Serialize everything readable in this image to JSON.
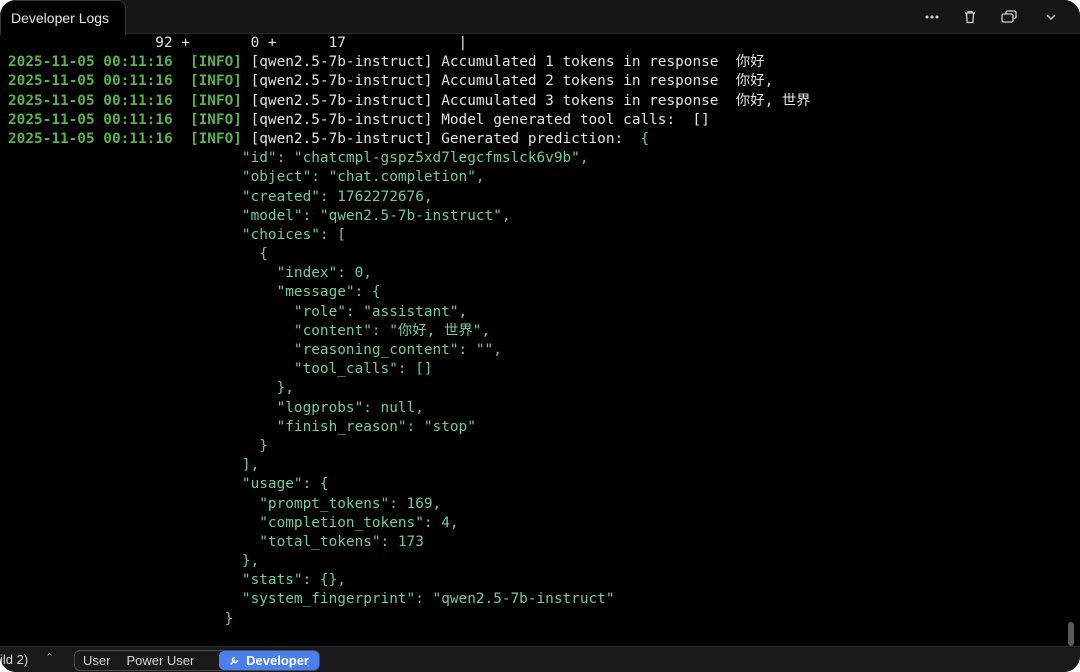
{
  "window": {
    "tab_title": "Developer Logs",
    "icons": [
      "more-icon",
      "trash-icon",
      "window-icon",
      "chevron-down-icon"
    ]
  },
  "log": {
    "header_row": "                 92 +       0 +      17             |",
    "entries": [
      {
        "timestamp": "2025-11-05 00:11:16",
        "level": "[INFO]",
        "message": "[qwen2.5-7b-instruct] Accumulated 1 tokens in response  你好"
      },
      {
        "timestamp": "2025-11-05 00:11:16",
        "level": "[INFO]",
        "message": "[qwen2.5-7b-instruct] Accumulated 2 tokens in response  你好,"
      },
      {
        "timestamp": "2025-11-05 00:11:16",
        "level": "[INFO]",
        "message": "[qwen2.5-7b-instruct] Accumulated 3 tokens in response  你好, 世界"
      },
      {
        "timestamp": "2025-11-05 00:11:16",
        "level": "[INFO]",
        "message": "[qwen2.5-7b-instruct] Model generated tool calls:  []"
      },
      {
        "timestamp": "2025-11-05 00:11:16",
        "level": "[INFO]",
        "message": "[qwen2.5-7b-instruct] Generated prediction:  "
      }
    ],
    "json_first": "{",
    "json_lines": [
      "  \"id\": \"chatcmpl-gspz5xd7legcfmslck6v9b\",",
      "  \"object\": \"chat.completion\",",
      "  \"created\": 1762272676,",
      "  \"model\": \"qwen2.5-7b-instruct\",",
      "  \"choices\": [",
      "    {",
      "      \"index\": 0,",
      "      \"message\": {",
      "        \"role\": \"assistant\",",
      "        \"content\": \"你好, 世界\",",
      "        \"reasoning_content\": \"\",",
      "        \"tool_calls\": []",
      "      },",
      "      \"logprobs\": null,",
      "      \"finish_reason\": \"stop\"",
      "    }",
      "  ],",
      "  \"usage\": {",
      "    \"prompt_tokens\": 169,",
      "    \"completion_tokens\": 4,",
      "    \"total_tokens\": 173",
      "  },",
      "  \"stats\": {},",
      "  \"system_fingerprint\": \"qwen2.5-7b-instruct\"",
      "}"
    ]
  },
  "footer": {
    "build_label": "ild 2)",
    "modes": [
      {
        "label": "User",
        "active": false
      },
      {
        "label": "Power User",
        "active": false
      },
      {
        "label": "Developer",
        "active": true
      }
    ]
  },
  "colors": {
    "background": "#000000",
    "timestamp": "#58b548",
    "json": "#6fcf97",
    "accent": "#4a7ff0"
  }
}
